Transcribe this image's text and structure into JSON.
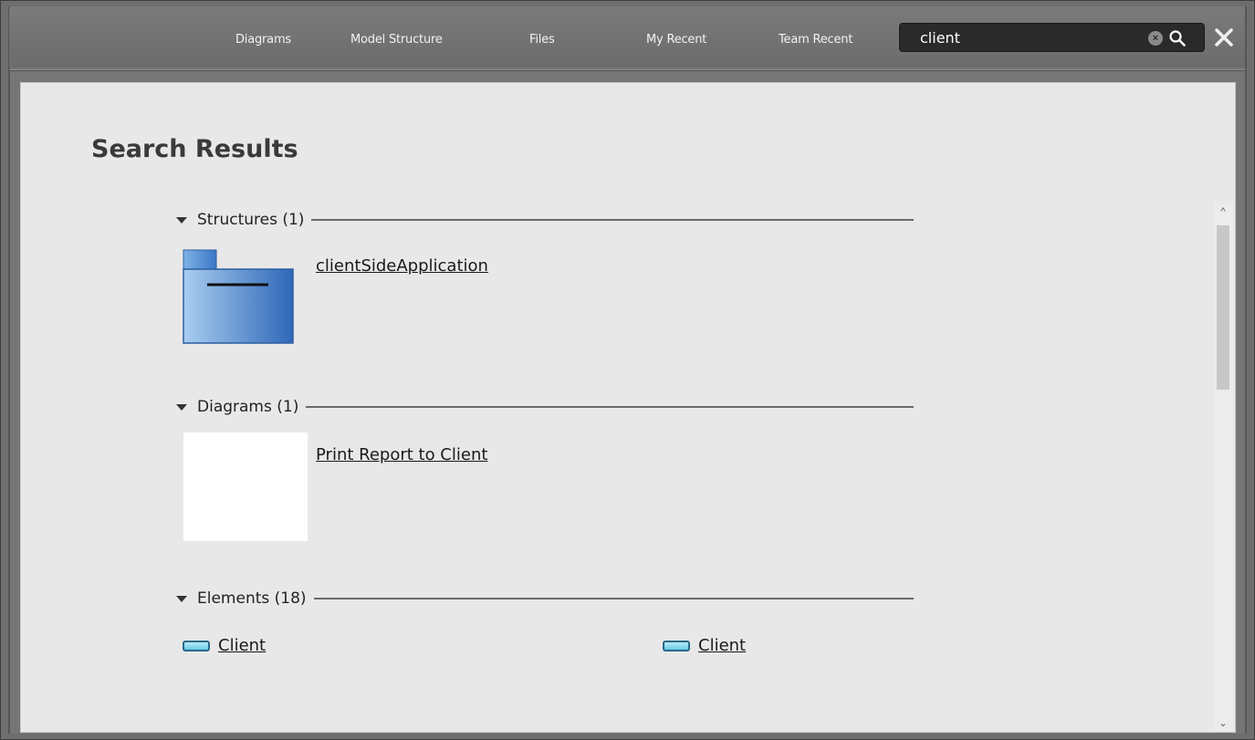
{
  "nav": {
    "items": [
      {
        "label": "Diagrams"
      },
      {
        "label": "Model Structure"
      },
      {
        "label": "Files"
      },
      {
        "label": "My Recent"
      },
      {
        "label": "Team Recent"
      }
    ]
  },
  "search": {
    "value": "client"
  },
  "page": {
    "title": "Search Results"
  },
  "sections": {
    "structures": {
      "label": "Structures (1)",
      "results": [
        {
          "label": "clientSideApplication"
        }
      ]
    },
    "diagrams": {
      "label": "Diagrams (1)",
      "results": [
        {
          "label": "Print Report to Client"
        }
      ]
    },
    "elements": {
      "label": "Elements (18)",
      "results": [
        {
          "label": "Client"
        },
        {
          "label": "Client"
        }
      ]
    }
  },
  "colors": {
    "topbar": "#6e6e6e",
    "panel": "#e8e8e8",
    "folder": "#3d82c9",
    "element_icon": "#6cc9e6"
  },
  "icons": {
    "folder": "folder-icon",
    "element": "class-element-icon",
    "search": "search-icon",
    "clear": "clear-icon",
    "close": "close-icon"
  }
}
